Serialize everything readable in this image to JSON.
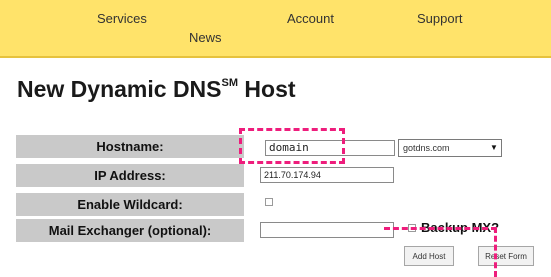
{
  "nav": {
    "services": "Services",
    "news": "News",
    "account": "Account",
    "support": "Support"
  },
  "page": {
    "title": "New Dynamic DNS",
    "title_sup": "SM",
    "title_suffix": " Host"
  },
  "form": {
    "hostname_label": "Hostname:",
    "hostname_value": "domain",
    "domain_separator": ".",
    "domain_select_value": "gotdns.com",
    "ip_label": "IP Address:",
    "ip_value": "211.70.174.94",
    "wildcard_label": "Enable Wildcard:",
    "wildcard_checked": false,
    "mx_label": "Mail Exchanger (optional):",
    "mx_value": "",
    "backup_mx_label": "Backup MX?",
    "backup_mx_checked": false
  },
  "buttons": {
    "add_host": "Add Host",
    "reset_form": "Reset Form"
  },
  "colors": {
    "nav_background": "#ffe36a",
    "label_background": "#c9c9c9",
    "highlight": "#ee1d7c"
  }
}
